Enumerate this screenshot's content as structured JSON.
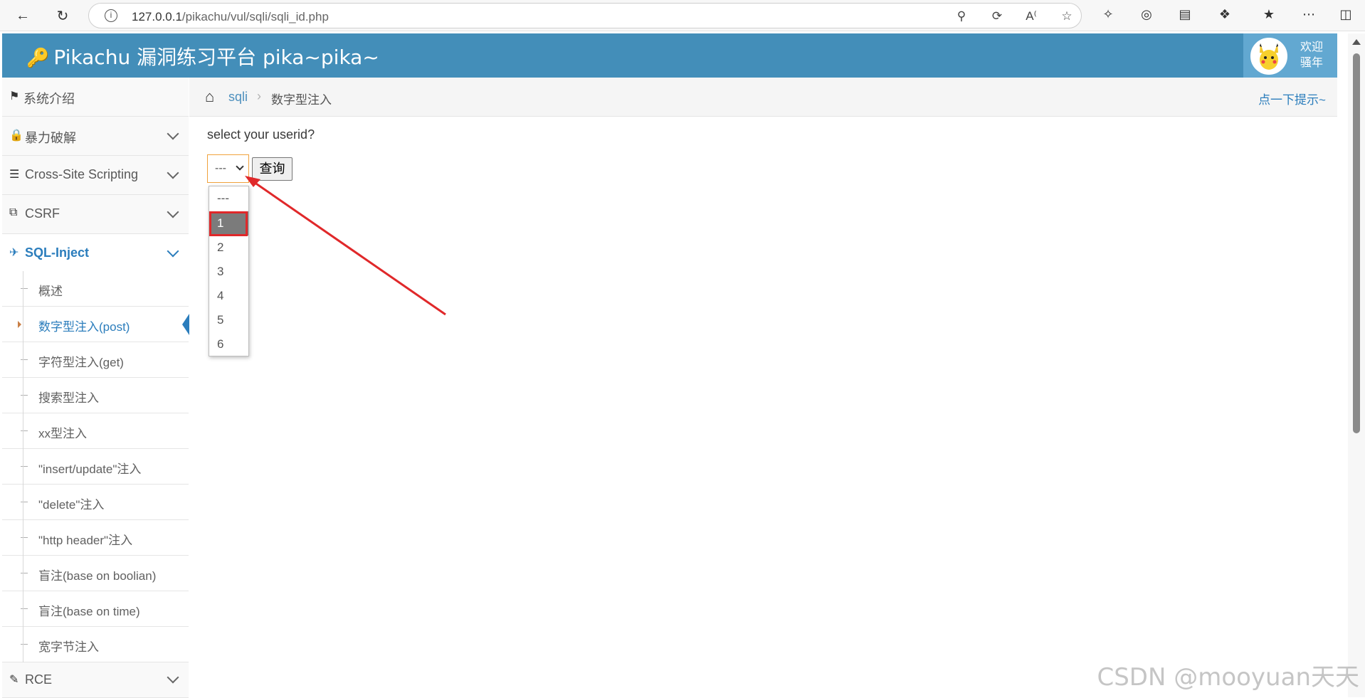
{
  "browser": {
    "url_host": "127.0.0.1",
    "url_path": "/pikachu/vul/sqli/sqli_id.php"
  },
  "header": {
    "title": "Pikachu 漏洞练习平台 pika~pika~",
    "welcome_line1": "欢迎",
    "welcome_line2": "骚年",
    "color": "#438eb9"
  },
  "sidebar": {
    "items": [
      {
        "label": "系统介绍",
        "icon": "tags-icon"
      },
      {
        "label": "暴力破解",
        "icon": "lock-icon"
      },
      {
        "label": "Cross-Site Scripting",
        "icon": "sitemap-icon"
      },
      {
        "label": "CSRF",
        "icon": "share-icon"
      },
      {
        "label": "SQL-Inject",
        "icon": "plane-icon"
      },
      {
        "label": "RCE",
        "icon": "pencil-icon"
      }
    ],
    "submenu": [
      "概述",
      "数字型注入(post)",
      "字符型注入(get)",
      "搜索型注入",
      "xx型注入",
      "\"insert/update\"注入",
      "\"delete\"注入",
      "\"http header\"注入",
      "盲注(base on boolian)",
      "盲注(base on time)",
      "宽字节注入"
    ],
    "active_color": "#2b7dbc"
  },
  "breadcrumb": {
    "parent": "sqli",
    "current": "数字型注入",
    "hint": "点一下提示~"
  },
  "form": {
    "question": "select your userid?",
    "selected_value": "---",
    "button_label": "查询",
    "options": [
      "---",
      "1",
      "2",
      "3",
      "4",
      "5",
      "6"
    ],
    "highlighted_option": "1"
  },
  "watermark": "CSDN @mooyuan天天",
  "annotation_color": "#e0282a"
}
